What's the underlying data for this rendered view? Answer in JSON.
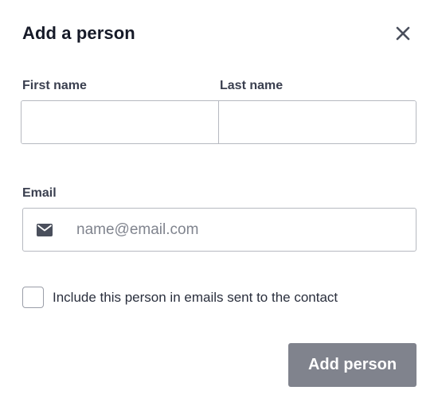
{
  "dialog": {
    "title": "Add a person",
    "close_icon": "close-icon"
  },
  "form": {
    "first_name_label": "First name",
    "first_name_value": "",
    "last_name_label": "Last name",
    "last_name_value": "",
    "email_label": "Email",
    "email_value": "",
    "email_placeholder": "name@email.com",
    "email_icon": "mail-icon",
    "include_checkbox_label": "Include this person in emails sent to the contact",
    "include_checked": false
  },
  "actions": {
    "submit_label": "Add person"
  },
  "colors": {
    "submit_bg": "#80838d",
    "border": "#b6b9c0",
    "title": "#161a28"
  }
}
